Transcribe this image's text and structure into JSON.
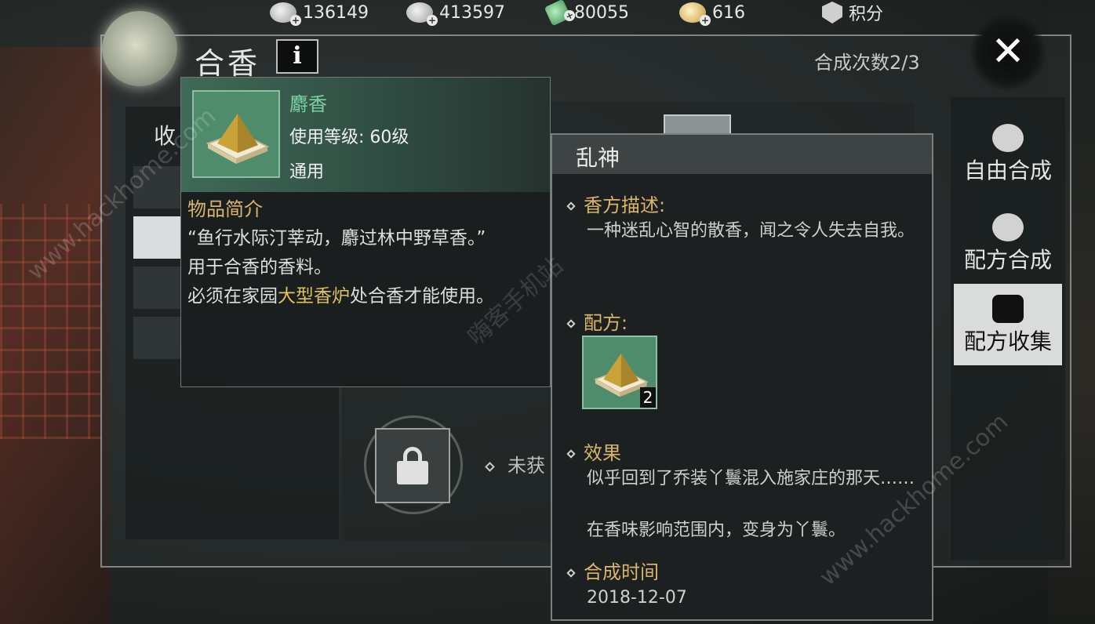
{
  "currencies": [
    {
      "icon": "silver-coin-icon",
      "value": "136149"
    },
    {
      "icon": "silver-ingot-icon",
      "value": "413597"
    },
    {
      "icon": "jade-icon",
      "value": "80055"
    },
    {
      "icon": "gold-ingot-icon",
      "value": "616"
    }
  ],
  "score": {
    "icon": "score-shield-icon",
    "label": "积分"
  },
  "header": {
    "title": "合香",
    "info_label": "i",
    "craft_count": "合成次数2/3",
    "close_label": "✕"
  },
  "left_panel": {
    "tab_label": "收"
  },
  "center": {
    "locked_status": "未获"
  },
  "right_nav": [
    {
      "icon": "free-craft-icon",
      "label": "自由合成",
      "active": false
    },
    {
      "icon": "recipe-craft-icon",
      "label": "配方合成",
      "active": false
    },
    {
      "icon": "recipe-collection-icon",
      "label": "配方收集",
      "active": true
    }
  ],
  "tooltip": {
    "item_name": "麝香",
    "level": "使用等级: 60级",
    "type": "通用",
    "section_title": "物品简介",
    "quote": "“鱼行水际汀莘动，麝过林中野草香。”",
    "usage": "用于合香的香料。",
    "note_prefix": "必须在家园",
    "note_highlight": "大型香炉",
    "note_suffix": "处合香才能使用。"
  },
  "detail": {
    "title": "乱神",
    "desc_label": "香方描述:",
    "desc_text": "一种迷乱心智的散香，闻之令人失去自我。",
    "recipe_label": "配方:",
    "recipe_qty": "2",
    "effect_label": "效果",
    "effect_text1": "似乎回到了乔装丫鬟混入施家庄的那天……",
    "effect_text2": "在香味影响范围内，变身为丫鬟。",
    "time_label": "合成时间",
    "time_value": "2018-12-07"
  },
  "watermarks": [
    "www.hackhome.com",
    "嗨客手机站",
    "www.hackhome.com"
  ],
  "colors": {
    "accent_gold": "#d9b56a",
    "item_green": "#7ad0a2",
    "panel_dark": "#1c2020"
  }
}
